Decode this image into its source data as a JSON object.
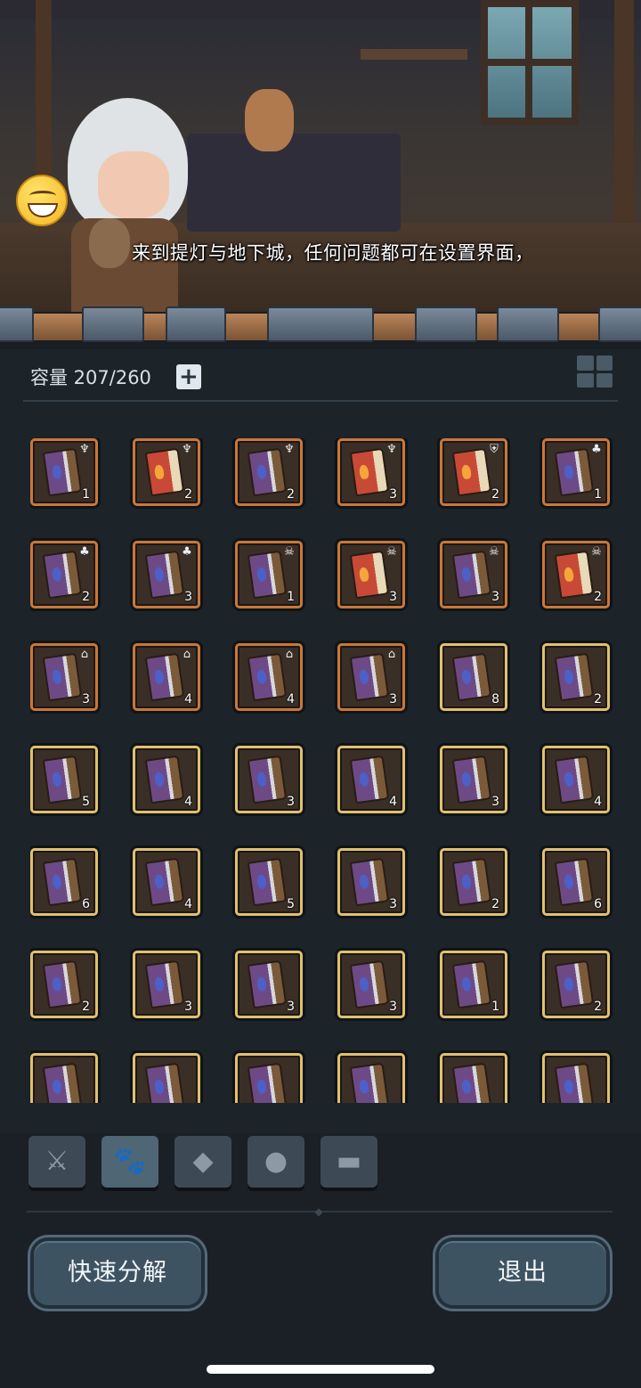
{
  "dialog": {
    "text": "来到提灯与地下城，任何问题都可在设置界面，"
  },
  "inventory": {
    "capacity_label": "容量 207/260",
    "expand_icon": "plus-icon",
    "layout_icon": "grid-icon"
  },
  "items": [
    {
      "type": "tome",
      "qty": "1",
      "rarity": "orange",
      "badge": "chalice"
    },
    {
      "type": "red-book",
      "qty": "2",
      "rarity": "orange",
      "badge": "chalice"
    },
    {
      "type": "tome",
      "qty": "2",
      "rarity": "orange",
      "badge": "chalice"
    },
    {
      "type": "red-book",
      "qty": "3",
      "rarity": "orange",
      "badge": "chalice"
    },
    {
      "type": "red-book",
      "qty": "2",
      "rarity": "orange",
      "badge": "shield"
    },
    {
      "type": "tome",
      "qty": "1",
      "rarity": "orange",
      "badge": "sprout"
    },
    {
      "type": "tome",
      "qty": "2",
      "rarity": "orange",
      "badge": "sprout"
    },
    {
      "type": "tome",
      "qty": "3",
      "rarity": "orange",
      "badge": "sprout"
    },
    {
      "type": "tome",
      "qty": "1",
      "rarity": "orange",
      "badge": "skull"
    },
    {
      "type": "red-book",
      "qty": "3",
      "rarity": "orange",
      "badge": "skull"
    },
    {
      "type": "tome",
      "qty": "3",
      "rarity": "orange",
      "badge": "skull"
    },
    {
      "type": "red-book",
      "qty": "2",
      "rarity": "orange",
      "badge": "skull"
    },
    {
      "type": "tome",
      "qty": "3",
      "rarity": "orange",
      "badge": "helmet"
    },
    {
      "type": "tome",
      "qty": "4",
      "rarity": "orange",
      "badge": "helmet"
    },
    {
      "type": "tome",
      "qty": "4",
      "rarity": "orange",
      "badge": "helmet"
    },
    {
      "type": "tome",
      "qty": "3",
      "rarity": "orange",
      "badge": "helmet"
    },
    {
      "type": "tome",
      "qty": "8",
      "rarity": "gold",
      "badge": ""
    },
    {
      "type": "tome",
      "qty": "2",
      "rarity": "gold",
      "badge": ""
    },
    {
      "type": "tome",
      "qty": "5",
      "rarity": "gold",
      "badge": ""
    },
    {
      "type": "tome",
      "qty": "4",
      "rarity": "gold",
      "badge": ""
    },
    {
      "type": "tome",
      "qty": "3",
      "rarity": "gold",
      "badge": ""
    },
    {
      "type": "tome",
      "qty": "4",
      "rarity": "gold",
      "badge": ""
    },
    {
      "type": "tome",
      "qty": "3",
      "rarity": "gold",
      "badge": ""
    },
    {
      "type": "tome",
      "qty": "4",
      "rarity": "gold",
      "badge": ""
    },
    {
      "type": "tome",
      "qty": "6",
      "rarity": "gold",
      "badge": ""
    },
    {
      "type": "tome",
      "qty": "4",
      "rarity": "gold",
      "badge": ""
    },
    {
      "type": "tome",
      "qty": "5",
      "rarity": "gold",
      "badge": ""
    },
    {
      "type": "tome",
      "qty": "3",
      "rarity": "gold",
      "badge": ""
    },
    {
      "type": "tome",
      "qty": "2",
      "rarity": "gold",
      "badge": ""
    },
    {
      "type": "tome",
      "qty": "6",
      "rarity": "gold",
      "badge": ""
    },
    {
      "type": "tome",
      "qty": "2",
      "rarity": "gold",
      "badge": ""
    },
    {
      "type": "tome",
      "qty": "3",
      "rarity": "gold",
      "badge": ""
    },
    {
      "type": "tome",
      "qty": "3",
      "rarity": "gold",
      "badge": ""
    },
    {
      "type": "tome",
      "qty": "3",
      "rarity": "gold",
      "badge": ""
    },
    {
      "type": "tome",
      "qty": "1",
      "rarity": "gold",
      "badge": ""
    },
    {
      "type": "tome",
      "qty": "2",
      "rarity": "gold",
      "badge": ""
    },
    {
      "type": "tome",
      "qty": "",
      "rarity": "gold",
      "badge": ""
    },
    {
      "type": "tome",
      "qty": "",
      "rarity": "gold",
      "badge": ""
    },
    {
      "type": "tome",
      "qty": "",
      "rarity": "gold",
      "badge": ""
    },
    {
      "type": "tome",
      "qty": "",
      "rarity": "gold",
      "badge": ""
    },
    {
      "type": "tome",
      "qty": "",
      "rarity": "gold",
      "badge": ""
    },
    {
      "type": "tome",
      "qty": "",
      "rarity": "gold",
      "badge": ""
    }
  ],
  "tabs": [
    {
      "icon": "sword-axe-icon",
      "active": false
    },
    {
      "icon": "paw-icon",
      "active": true
    },
    {
      "icon": "gem-icon",
      "active": false
    },
    {
      "icon": "ore-icon",
      "active": false
    },
    {
      "icon": "chest-icon",
      "active": false
    }
  ],
  "buttons": {
    "quick_decompose": "快速分解",
    "exit": "退出"
  },
  "colors": {
    "orange_frame": "#c9773a",
    "gold_frame": "#e0c070",
    "panel": "#1c2329",
    "button": "#3e5362"
  }
}
